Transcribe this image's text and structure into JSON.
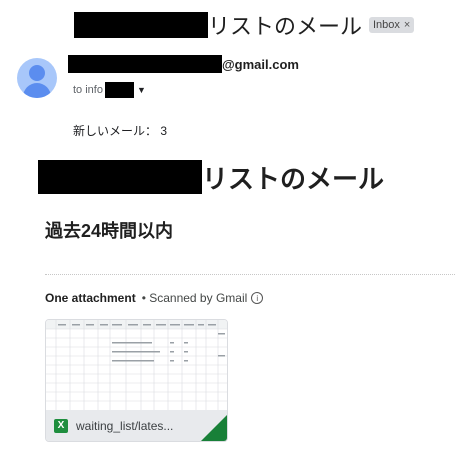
{
  "subject": {
    "text": "リストのメール",
    "label": "Inbox",
    "close": "×"
  },
  "sender": {
    "email_suffix": "@gmail.com",
    "to_prefix": "to info"
  },
  "body": {
    "new_mail": "新しいメール： 3",
    "heading": "リストのメール",
    "subheading": "過去24時間以内"
  },
  "attachment": {
    "title": "One attachment",
    "scanned": "• Scanned by Gmail",
    "filename": "waiting_list/lates...",
    "icon_letter": "X",
    "sheet_rows": [
      [
        "1",
        "",
        "",
        "",
        "",
        "",
        "",
        "",
        "",
        "",
        "",
        "",
        ""
      ],
      [
        "2",
        "",
        "",
        "",
        "",
        "",
        "",
        "",
        "",
        "",
        "",
        "",
        ""
      ],
      [
        "3",
        "",
        "",
        "",
        "",
        "",
        "",
        "",
        "",
        "",
        "",
        "",
        ""
      ],
      [
        "4",
        "",
        "",
        "",
        "",
        "",
        "",
        "",
        "",
        "",
        "",
        "",
        ""
      ],
      [
        "5",
        "",
        "",
        "",
        "",
        "",
        "",
        "",
        "",
        "",
        "",
        "",
        ""
      ],
      [
        "6",
        "",
        "",
        "",
        "",
        "",
        "",
        "",
        "",
        "",
        "",
        "",
        ""
      ],
      [
        "7",
        "",
        "",
        "",
        "",
        "",
        "",
        "",
        "",
        "",
        "",
        "",
        ""
      ],
      [
        "8",
        "",
        "",
        "",
        "",
        "",
        "",
        "",
        "",
        "",
        "",
        "",
        ""
      ]
    ],
    "colors": {
      "excel_green": "#1e8e3e",
      "fold_green": "#188038"
    }
  }
}
